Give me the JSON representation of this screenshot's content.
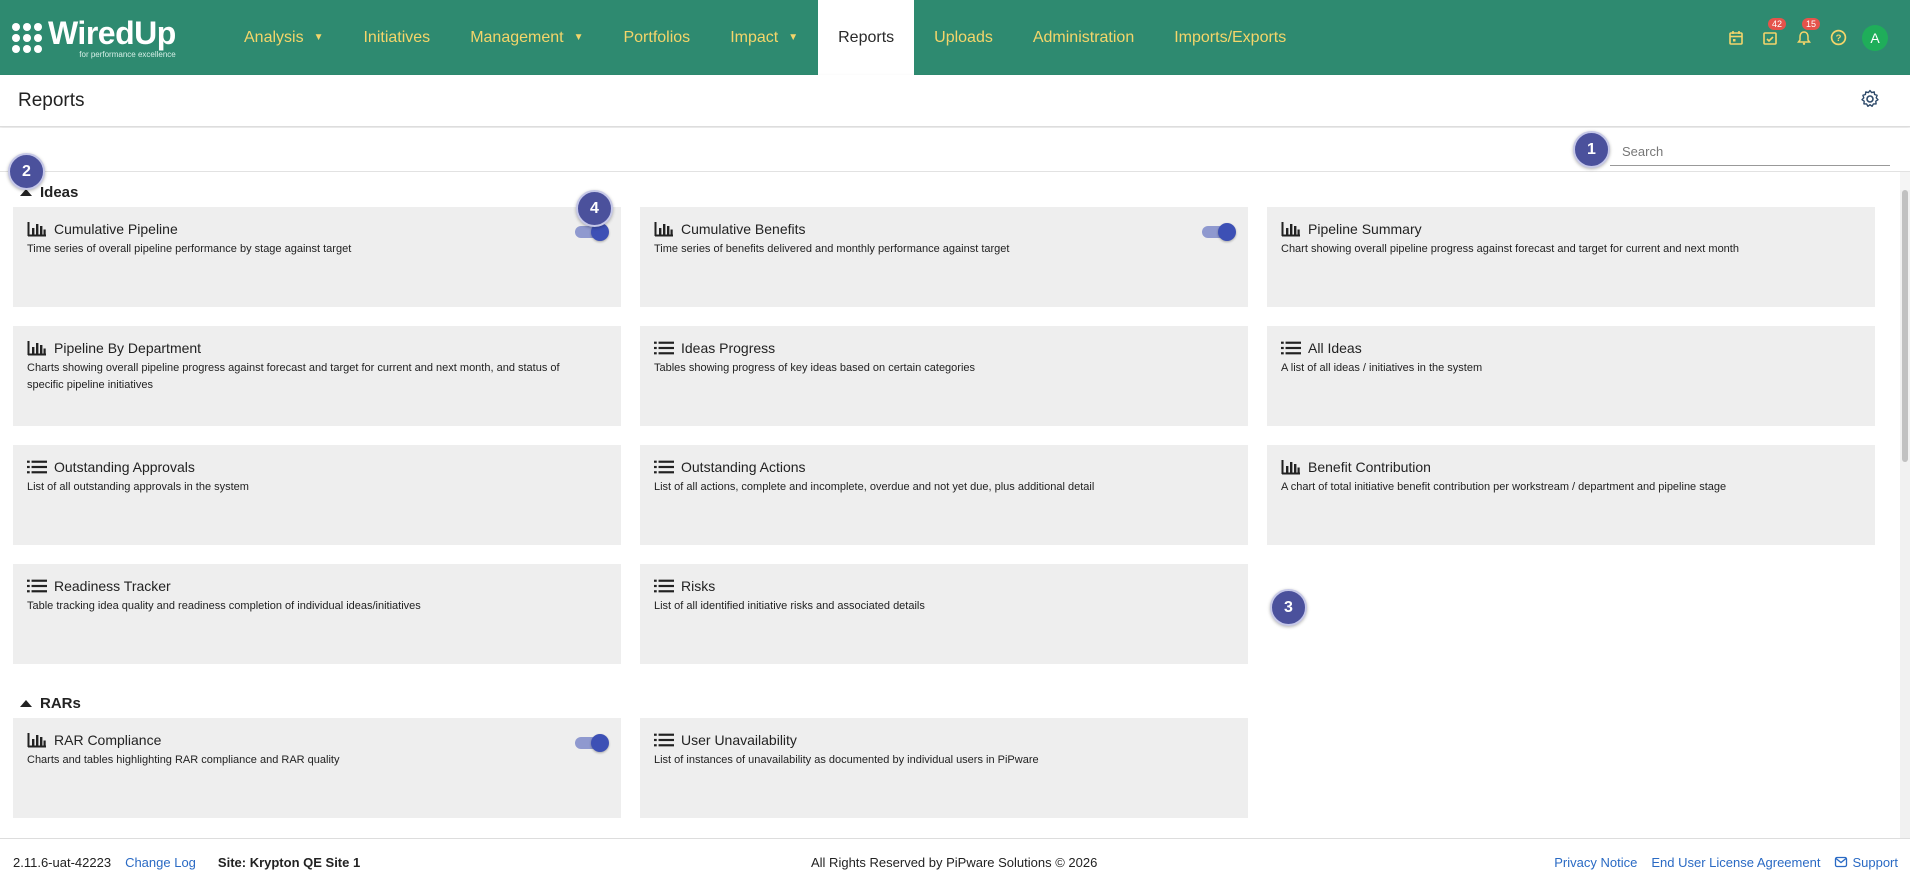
{
  "brand": {
    "name": "WiredUp",
    "tagline": "for performance excellence"
  },
  "nav": {
    "items": [
      {
        "label": "Analysis",
        "dropdown": true
      },
      {
        "label": "Initiatives",
        "dropdown": false
      },
      {
        "label": "Management",
        "dropdown": true
      },
      {
        "label": "Portfolios",
        "dropdown": false
      },
      {
        "label": "Impact",
        "dropdown": true
      },
      {
        "label": "Reports",
        "dropdown": false,
        "active": true
      },
      {
        "label": "Uploads",
        "dropdown": false
      },
      {
        "label": "Administration",
        "dropdown": false
      },
      {
        "label": "Imports/Exports",
        "dropdown": false
      }
    ],
    "tasks_count": "42",
    "notifications_count": "15",
    "avatar_initial": "A"
  },
  "header": {
    "title": "Reports"
  },
  "search": {
    "placeholder": "Search"
  },
  "markers": [
    "1",
    "2",
    "3",
    "4"
  ],
  "sections": [
    {
      "title": "Ideas",
      "cards": [
        {
          "title": "Cumulative Pipeline",
          "desc": "Time series of overall pipeline performance by stage against target",
          "icon": "bar-chart-icon",
          "toggle": true
        },
        {
          "title": "Cumulative Benefits",
          "desc": "Time series of benefits delivered and monthly performance against target",
          "icon": "bar-chart-icon",
          "toggle": true
        },
        {
          "title": "Pipeline Summary",
          "desc": "Chart showing overall pipeline progress against forecast and target for current and next month",
          "icon": "bar-chart-icon",
          "toggle": false
        },
        {
          "title": "Pipeline By Department",
          "desc": "Charts showing overall pipeline progress against forecast and target for current and next month, and status of specific pipeline initiatives",
          "icon": "bar-chart-icon",
          "toggle": false
        },
        {
          "title": "Ideas Progress",
          "desc": "Tables showing progress of key ideas based on certain categories",
          "icon": "list-icon",
          "toggle": false
        },
        {
          "title": "All Ideas",
          "desc": "A list of all ideas / initiatives in the system",
          "icon": "list-icon",
          "toggle": false
        },
        {
          "title": "Outstanding Approvals",
          "desc": "List of all outstanding approvals in the system",
          "icon": "list-icon",
          "toggle": false
        },
        {
          "title": "Outstanding Actions",
          "desc": "List of all actions, complete and incomplete, overdue and not yet due, plus additional detail",
          "icon": "list-icon",
          "toggle": false
        },
        {
          "title": "Benefit Contribution",
          "desc": "A chart of total initiative benefit contribution per workstream / department and pipeline stage",
          "icon": "bar-chart-icon",
          "toggle": false
        },
        {
          "title": "Readiness Tracker",
          "desc": "Table tracking idea quality and readiness completion of individual ideas/initiatives",
          "icon": "list-icon",
          "toggle": false
        },
        {
          "title": "Risks",
          "desc": "List of all identified initiative risks and associated details",
          "icon": "list-icon",
          "toggle": false
        }
      ]
    },
    {
      "title": "RARs",
      "cards": [
        {
          "title": "RAR Compliance",
          "desc": "Charts and tables highlighting RAR compliance and RAR quality",
          "icon": "bar-chart-icon",
          "toggle": true
        },
        {
          "title": "User Unavailability",
          "desc": "List of instances of unavailability as documented by individual users in PiPware",
          "icon": "list-icon",
          "toggle": false
        }
      ]
    }
  ],
  "footer": {
    "version": "2.11.6-uat-42223",
    "changelog": "Change Log",
    "site": "Site: Krypton QE Site 1",
    "rights": "All Rights Reserved by PiPware Solutions © 2026",
    "privacy": "Privacy Notice",
    "eula": "End User License Agreement",
    "support": "Support"
  }
}
